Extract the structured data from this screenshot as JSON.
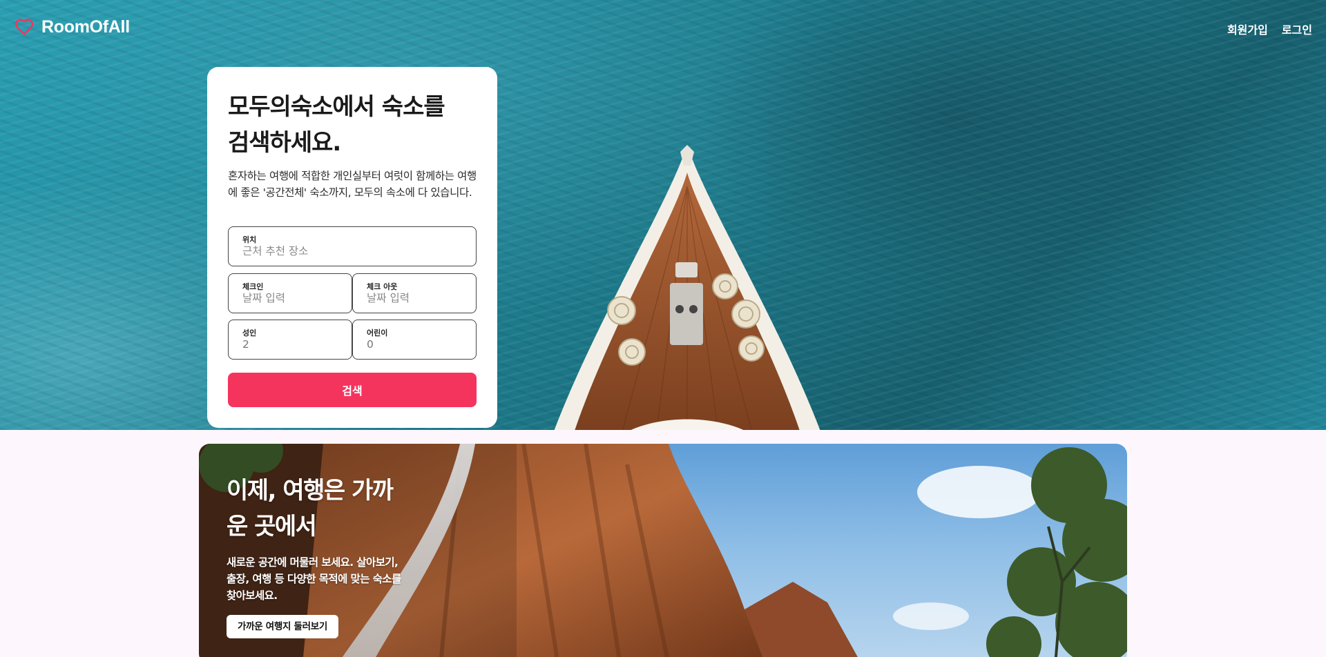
{
  "nav": {
    "brand": "RoomOfAll",
    "signup": "회원가입",
    "login": "로그인"
  },
  "search": {
    "title_line1": "모두의숙소에서 숙소를",
    "title_line2": "검색하세요.",
    "description": "혼자하는 여행에 적합한 개인실부터 여럿이 함께하는 여행에 좋은 '공간전체' 숙소까지, 모두의 속소에 다 있습니다.",
    "location": {
      "label": "위치",
      "placeholder": "근처 추천 장소"
    },
    "checkin": {
      "label": "체크인",
      "placeholder": "날짜 입력"
    },
    "checkout": {
      "label": "체크 아웃",
      "placeholder": "날짜 입력"
    },
    "adults": {
      "label": "성인",
      "value": "2"
    },
    "children": {
      "label": "어린이",
      "value": "0"
    },
    "button": "검색"
  },
  "promo": {
    "title_line1": "이제, 여행은 가까",
    "title_line2": "운 곳에서",
    "description": "새로운 공간에 머물러 보세요. 살아보기, 출장, 여행 등 다양한 목적에 맞는 숙소를 찾아보세요.",
    "button": "가까운 여행지 둘러보기"
  },
  "colors": {
    "accent": "#f5345e",
    "ocean": "#1f8799",
    "card": "#ffffff",
    "page_bg": "#fdf6fd"
  },
  "icons": {
    "logo": "heart-outline-icon"
  }
}
